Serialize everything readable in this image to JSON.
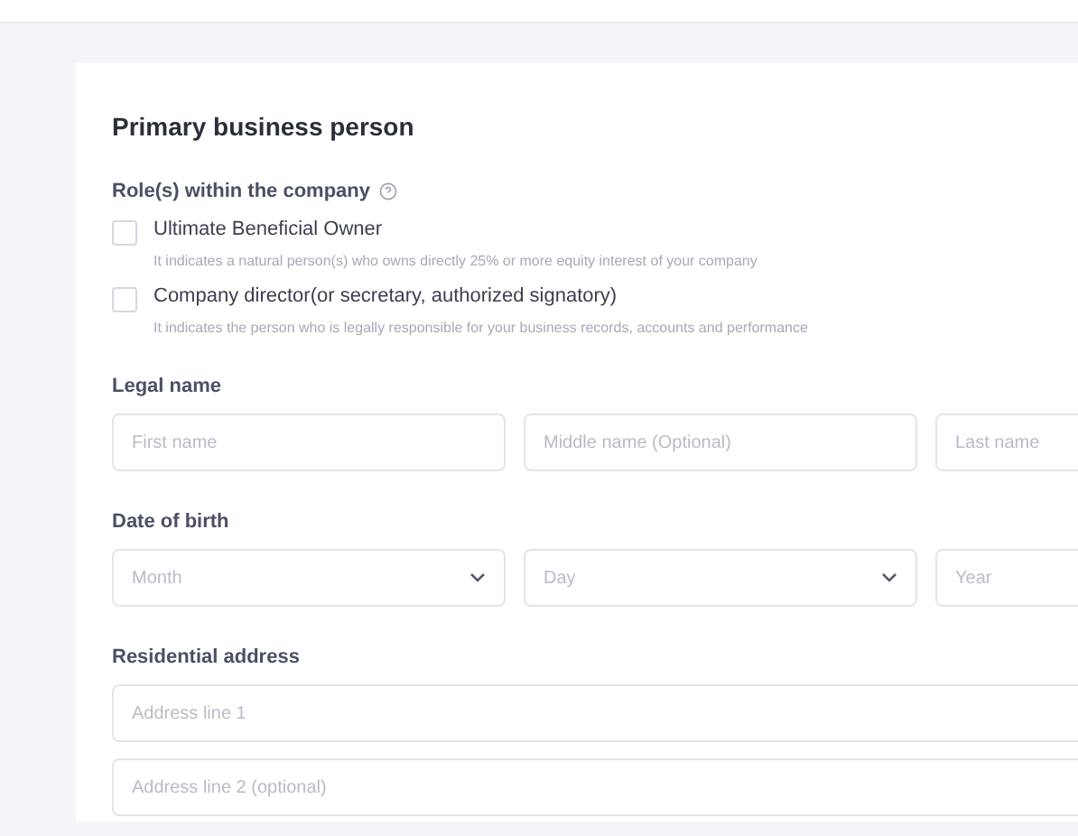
{
  "section": {
    "title": "Primary business person"
  },
  "roles": {
    "label": "Role(s) within the company",
    "options": [
      {
        "label": "Ultimate Beneficial Owner",
        "hint": "It indicates a natural person(s) who owns directly 25% or more equity interest of your company",
        "checked": false
      },
      {
        "label": "Company director(or secretary, authorized signatory)",
        "hint": "It indicates the person who is legally responsible for your business records, accounts and performance",
        "checked": false
      }
    ]
  },
  "groups": [
    {
      "label": "Legal name",
      "rows": [
        [
          {
            "kind": "input",
            "placeholder": "First name"
          },
          {
            "kind": "input",
            "placeholder": "Middle name (Optional)"
          },
          {
            "kind": "input",
            "placeholder": "Last name"
          }
        ]
      ]
    },
    {
      "label": "Date of birth",
      "rows": [
        [
          {
            "kind": "select",
            "placeholder": "Month"
          },
          {
            "kind": "select",
            "placeholder": "Day"
          },
          {
            "kind": "input",
            "placeholder": "Year"
          }
        ]
      ]
    },
    {
      "label": "Residential address",
      "rows": [
        [
          {
            "kind": "wide",
            "placeholder": "Address line 1"
          }
        ],
        [
          {
            "kind": "wide",
            "placeholder": "Address line 2 (optional)"
          }
        ]
      ]
    }
  ]
}
